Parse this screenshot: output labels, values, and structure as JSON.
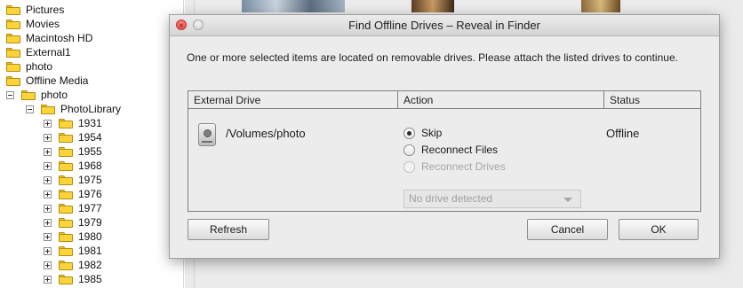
{
  "tree": {
    "items": [
      {
        "label": "Pictures",
        "expander": "",
        "level": 0
      },
      {
        "label": "Movies",
        "expander": "",
        "level": 0
      },
      {
        "label": "Macintosh HD",
        "expander": "",
        "level": 0
      },
      {
        "label": "External1",
        "expander": "",
        "level": 0
      },
      {
        "label": "photo",
        "expander": "",
        "level": 0
      },
      {
        "label": "Offline Media",
        "expander": "",
        "level": 0
      },
      {
        "label": "photo",
        "expander": "minus",
        "level": 1
      },
      {
        "label": "PhotoLibrary",
        "expander": "minus",
        "level": 2
      },
      {
        "label": "1931",
        "expander": "plus",
        "level": 3
      },
      {
        "label": "1954",
        "expander": "plus",
        "level": 3
      },
      {
        "label": "1955",
        "expander": "plus",
        "level": 3
      },
      {
        "label": "1968",
        "expander": "plus",
        "level": 3
      },
      {
        "label": "1975",
        "expander": "plus",
        "level": 3
      },
      {
        "label": "1976",
        "expander": "plus",
        "level": 3
      },
      {
        "label": "1977",
        "expander": "plus",
        "level": 3
      },
      {
        "label": "1979",
        "expander": "plus",
        "level": 3
      },
      {
        "label": "1980",
        "expander": "plus",
        "level": 3
      },
      {
        "label": "1981",
        "expander": "plus",
        "level": 3
      },
      {
        "label": "1982",
        "expander": "plus",
        "level": 3
      },
      {
        "label": "1985",
        "expander": "plus",
        "level": 3
      }
    ]
  },
  "dialog": {
    "title": "Find Offline Drives – Reveal in Finder",
    "message": "One or more selected items are located on removable drives.  Please attach the listed drives to continue.",
    "table": {
      "headers": {
        "drive": "External Drive",
        "action": "Action",
        "status": "Status"
      },
      "row": {
        "drive_path": "/Volumes/photo",
        "status": "Offline",
        "options": [
          {
            "label": "Skip",
            "selected": true,
            "enabled": true
          },
          {
            "label": "Reconnect Files",
            "selected": false,
            "enabled": true
          },
          {
            "label": "Reconnect Drives",
            "selected": false,
            "enabled": false
          }
        ],
        "drive_select": "No drive detected"
      }
    },
    "buttons": {
      "refresh": "Refresh",
      "cancel": "Cancel",
      "ok": "OK"
    }
  },
  "icons": {
    "folder": "folder-icon",
    "drive": "external-drive-icon",
    "close": "close-icon",
    "minimize": "minimize-icon",
    "dropdown": "chevron-down-icon"
  },
  "colors": {
    "folder": "#fbd43a",
    "close_button": "#e0443e",
    "dialog_bg": "#ececec"
  }
}
